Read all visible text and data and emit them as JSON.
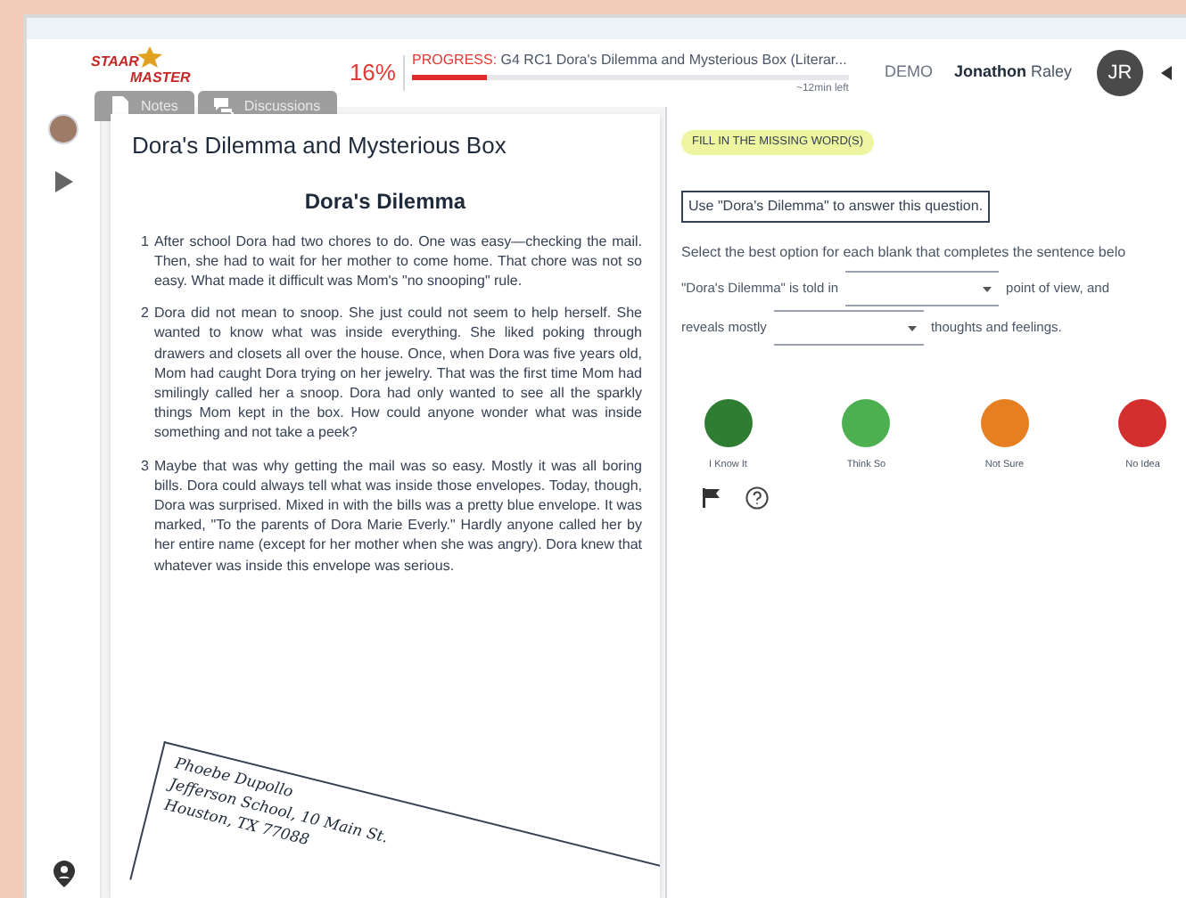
{
  "header": {
    "logo": {
      "line_1": "STAAR",
      "line_2": "MASTER"
    },
    "percent": "16%",
    "progress": {
      "label": "PROGRESS:",
      "title": "G4 RC1 Dora's Dilemma and Mysterious Box (Literar...",
      "level": 0.17,
      "time_left": "~12min left"
    },
    "mode": "DEMO",
    "user": {
      "first_name": "Jonathon",
      "last_name": "Raley",
      "initials": "JR"
    }
  },
  "tabs": [
    {
      "label": "Notes",
      "kind": "note"
    },
    {
      "label": "Discussions",
      "kind": "chat"
    }
  ],
  "passage": {
    "title": "Dora's Dilemma and Mysterious Box",
    "heading": "Dora's Dilemma",
    "paragraphs": [
      {
        "number": "1",
        "text": "After school Dora had two chores to do. One was easy—checking the mail. Then, she had to wait for her mother to come home. That chore was not so easy. What made it difficult was Mom's \"no snooping\" rule."
      },
      {
        "number": "2",
        "text": "Dora did not mean to snoop. She just could not seem to help herself. She wanted to know what was inside everything. She liked poking through drawers and closets all over the house. Once, when Dora was five years old, Mom had caught Dora trying on her jewelry. That was the first time Mom had smilingly called her a snoop. Dora had only wanted to see all the sparkly things Mom kept in the box. How could anyone wonder what was inside something and not take a peek?"
      },
      {
        "number": "3",
        "text": "Maybe that was why getting the mail was so easy. Mostly it was all boring bills. Dora could always tell what was inside those envelopes. Today, though, Dora was surprised. Mixed in with the bills was a pretty blue envelope. It was marked, \"To the parents of Dora Marie Everly.\" Hardly anyone called her by her entire name (except for her mother when she was angry). Dora knew that whatever was inside this envelope was serious."
      }
    ],
    "envelope": [
      "Phoebe Dupollo",
      "Jefferson School, 10 Main St.",
      "Houston, TX 77088"
    ]
  },
  "question": {
    "type_badge": "FILL IN THE MISSING WORD(S)",
    "instruction": "Use \"Dora's Dilemma\" to answer this question.",
    "prompt": "Select the best option for each blank that completes the sentence belo",
    "lines": [
      {
        "before": "\"Dora's Dilemma\" is told in",
        "after": "point of view, and"
      },
      {
        "before": "reveals mostly",
        "after": "thoughts and feelings."
      }
    ]
  },
  "confidence": [
    {
      "label": "I Know It",
      "color": "#2e7d32"
    },
    {
      "label": "Think So",
      "color": "#4caf50"
    },
    {
      "label": "Not Sure",
      "color": "#e67e22"
    },
    {
      "label": "No Idea",
      "color": "#d32f2f"
    }
  ]
}
